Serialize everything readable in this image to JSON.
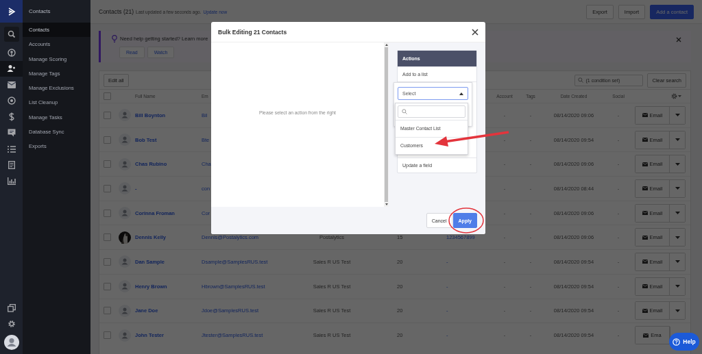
{
  "rail": {
    "items": [
      {
        "selected": false
      },
      {
        "selected": false
      },
      {
        "selected": true
      },
      {
        "selected": false
      },
      {
        "selected": false
      },
      {
        "selected": false
      },
      {
        "selected": false
      },
      {
        "selected": false
      },
      {
        "selected": false
      },
      {
        "selected": false
      }
    ]
  },
  "sidebar": {
    "title": "Contacts",
    "items": [
      {
        "label": "Contacts",
        "selected": true
      },
      {
        "label": "Accounts",
        "selected": false
      },
      {
        "label": "Manage Scoring",
        "selected": false
      },
      {
        "label": "Manage Tags",
        "selected": false
      },
      {
        "label": "Manage Exclusions",
        "selected": false
      },
      {
        "label": "List Cleanup",
        "selected": false
      },
      {
        "label": "Manage Tasks",
        "selected": false
      },
      {
        "label": "Database Sync",
        "selected": false
      },
      {
        "label": "Exports",
        "selected": false
      }
    ]
  },
  "header": {
    "title": "Contacts (21)",
    "subtitle": "Last updated a few seconds ago.",
    "link": "Update now",
    "buttons": [
      {
        "label": "Export",
        "primary": false
      },
      {
        "label": "Import",
        "primary": false
      },
      {
        "label": "Add a contact",
        "primary": true
      }
    ]
  },
  "banner": {
    "text": "Need help getting started? Learn more",
    "buttons": [
      "Read",
      "Watch"
    ]
  },
  "toolbar": {
    "edit_button": "Edit all",
    "search_value": "(1 condition set)",
    "clear_button": "Clear search"
  },
  "table": {
    "all_selected": false,
    "columns": {
      "name": "Full Name",
      "email": "Em",
      "account": "Account",
      "tags": "Tags",
      "date": "Date Created",
      "social": "Social"
    },
    "rows": [
      {
        "selected": false,
        "has_photo": false,
        "name": "Bill Boynton",
        "email": "Bil",
        "account": "-",
        "tags": "-",
        "date": "08/14/2020 09:06",
        "social": "-",
        "action": "Email",
        "has_menu": true
      },
      {
        "selected": false,
        "has_photo": false,
        "name": "Bob Test",
        "email": "Bte",
        "account": "-",
        "tags": "-",
        "date": "08/14/2020 09:54",
        "social": "-",
        "action": "Email",
        "has_menu": true
      },
      {
        "selected": false,
        "has_photo": false,
        "name": "Chas Rubino",
        "email": "Cha",
        "account": "-",
        "tags": "-",
        "date": "08/14/2020 09:06",
        "social": "-",
        "action": "Email",
        "has_menu": true
      },
      {
        "selected": false,
        "has_photo": false,
        "name": "-",
        "email": "con",
        "account": "-",
        "tags": "-",
        "date": "08/14/2020 08:44",
        "social": "-",
        "action": "Email",
        "has_menu": true
      },
      {
        "selected": false,
        "has_photo": false,
        "name": "Corinna Froman",
        "email": "Cor",
        "account": "-",
        "tags": "-",
        "date": "08/14/2020 09:06",
        "social": "-",
        "action": "Email",
        "has_menu": true
      },
      {
        "selected": false,
        "has_photo": true,
        "name": "Dennis Kelly",
        "email": "Dennis@Postalytics.com",
        "company": "Postalytics",
        "score": "15",
        "phone": "1234567899",
        "account": "-",
        "tags": "-",
        "date": "08/14/2020 09:06",
        "social": "-",
        "action": "Email",
        "has_menu": true
      },
      {
        "selected": false,
        "has_photo": false,
        "name": "Dan Sample",
        "email": "Dsample@SamplesRUS.test",
        "company": "Sales R US Test",
        "score": "20",
        "phone": "-",
        "account": "-",
        "tags": "-",
        "date": "08/14/2020 09:54",
        "social": "-",
        "action": "Email",
        "has_menu": true
      },
      {
        "selected": false,
        "has_photo": false,
        "name": "Henry Brown",
        "email": "Hbrown@SamplesRUS.test",
        "company": "Sales R US Test",
        "score": "20",
        "phone": "-",
        "account": "-",
        "tags": "-",
        "date": "08/14/2020 09:54",
        "social": "-",
        "action": "Email",
        "has_menu": true
      },
      {
        "selected": false,
        "has_photo": false,
        "name": "Jane Doe",
        "email": "Jdoe@SamplesRUS.test",
        "company": "Sales R US Test",
        "score": "20",
        "phone": "-",
        "account": "-",
        "tags": "-",
        "date": "08/14/2020 09:54",
        "social": "-",
        "action": "Email",
        "has_menu": true
      },
      {
        "selected": false,
        "has_photo": false,
        "name": "John Tester",
        "email": "Jtester@SamplesRUS.test",
        "company": "Sales R US Test",
        "score": "20",
        "phone": "-",
        "account": "-",
        "tags": "-",
        "date": "08/14/2020 09:54",
        "social": "-",
        "action": "Ema",
        "has_menu": false
      }
    ]
  },
  "modal": {
    "title": "Bulk Editing 21 Contacts",
    "placeholder_text": "Please select an action from the right",
    "actions_title": "Actions",
    "actions": [
      "Add to a list",
      "Update a field"
    ],
    "select": {
      "value": "Select",
      "expanded": true
    },
    "options": [
      "Master Contact List",
      "Customers"
    ],
    "buttons": [
      {
        "label": "Cancel",
        "primary": false
      },
      {
        "label": "Apply",
        "primary": true
      }
    ]
  },
  "help_button": "Help"
}
